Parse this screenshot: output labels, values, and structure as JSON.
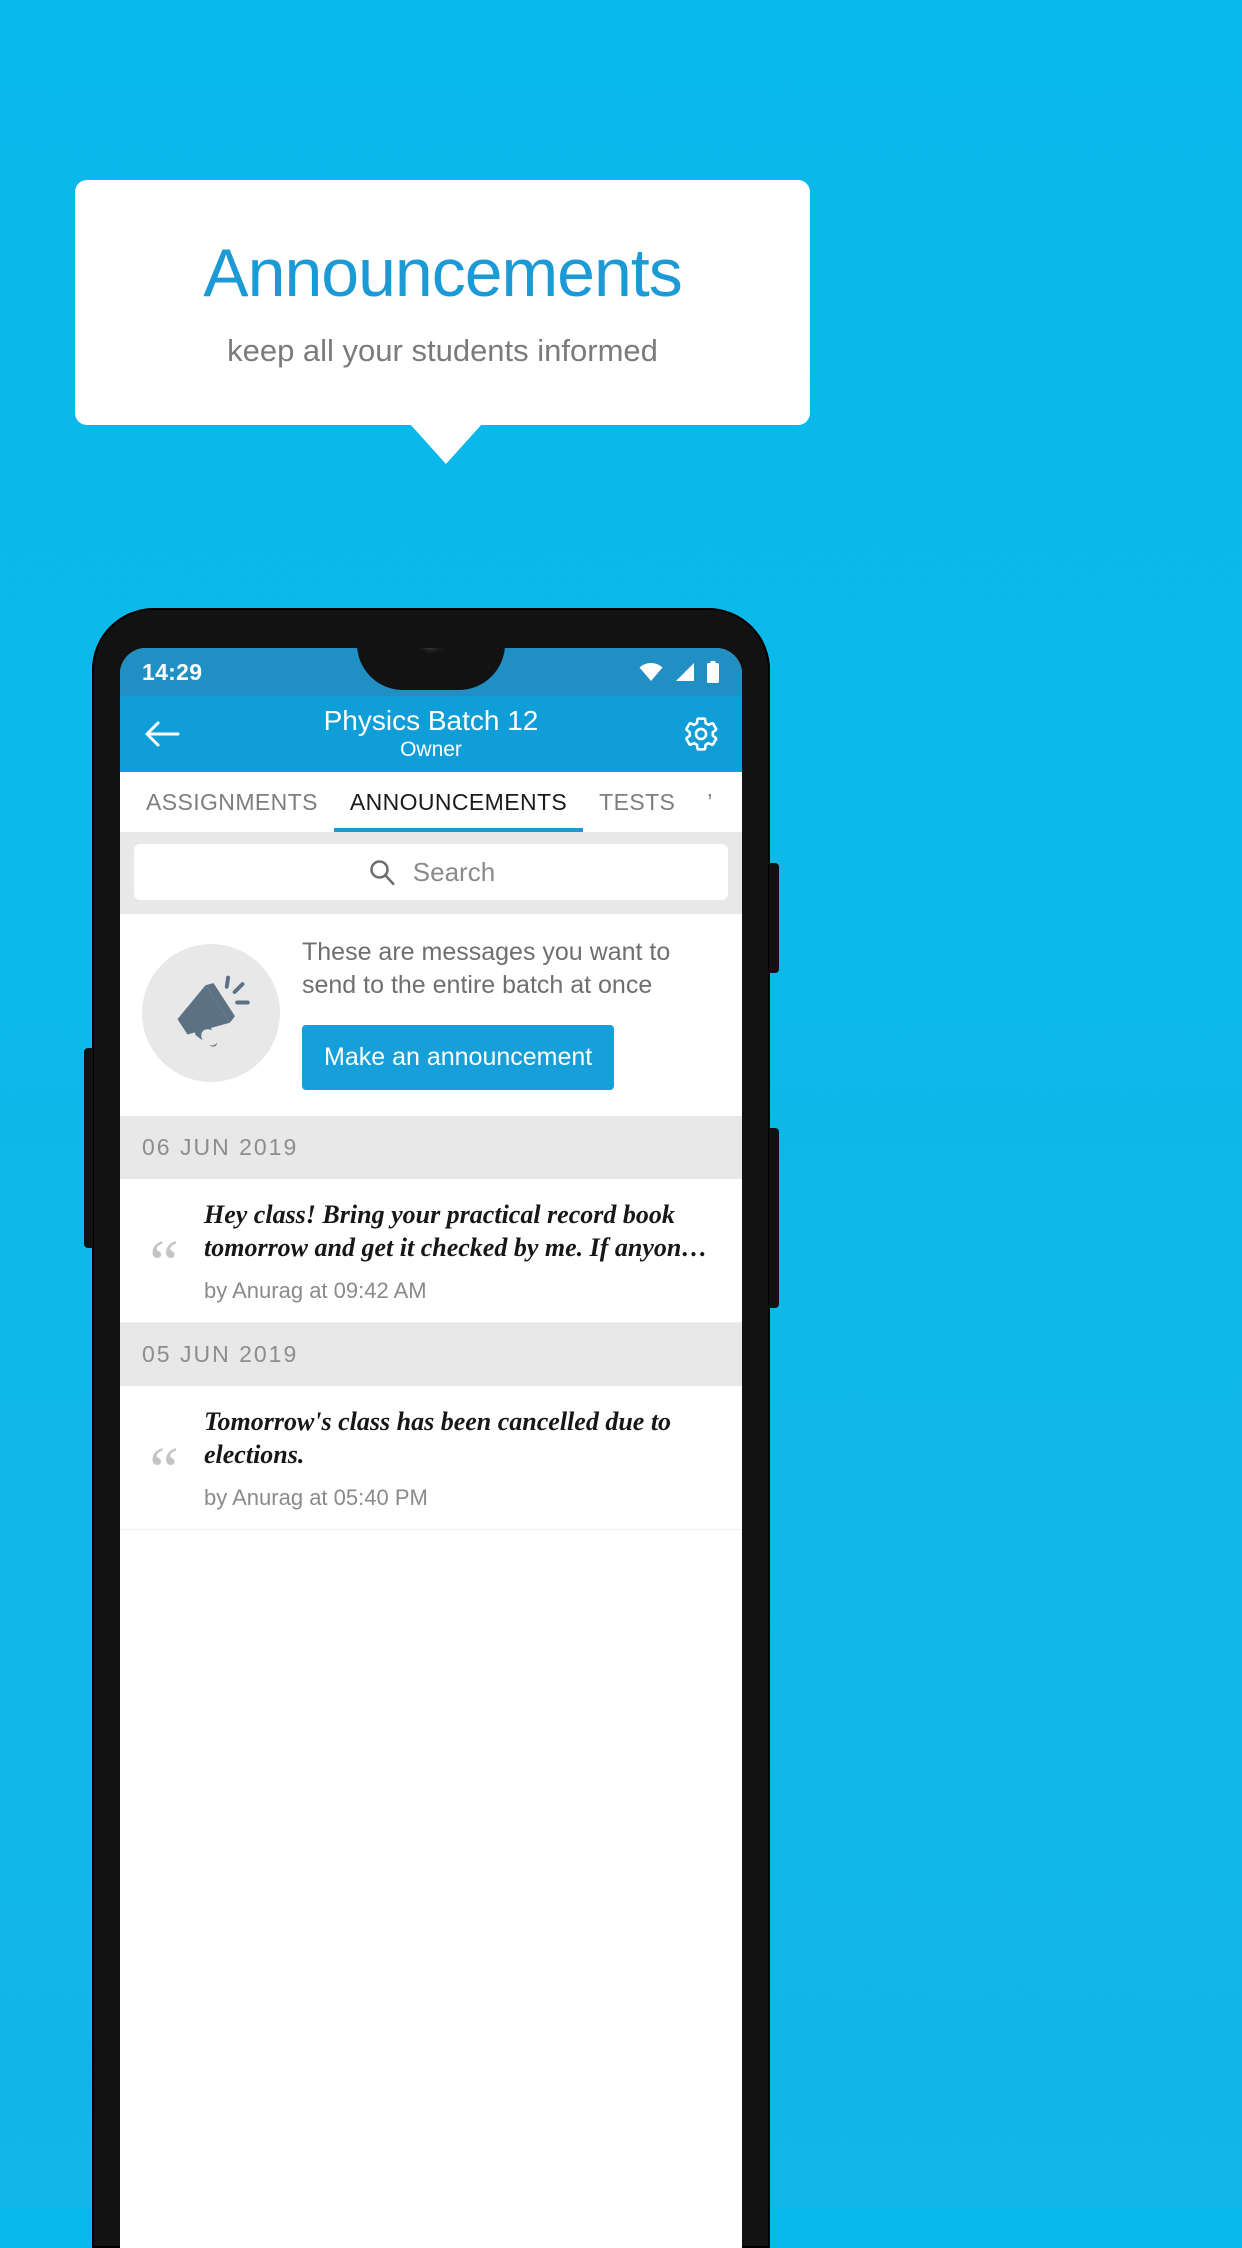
{
  "promo": {
    "title": "Announcements",
    "subtitle": "keep all your students informed",
    "title_color": "#1b9ad6",
    "background_color": "#0cb9ea"
  },
  "phone": {
    "status_bar": {
      "time": "14:29",
      "icons": [
        "wifi-icon",
        "signal-icon",
        "battery-icon"
      ]
    },
    "app_bar": {
      "back_icon": "back-arrow-icon",
      "title": "Physics Batch 12",
      "subtitle": "Owner",
      "settings_icon": "gear-icon",
      "color": "#109ed8"
    },
    "tabs": [
      {
        "label": "ASSIGNMENTS",
        "active": false
      },
      {
        "label": "ANNOUNCEMENTS",
        "active": true
      },
      {
        "label": "TESTS",
        "active": false
      },
      {
        "label": "’",
        "active": false
      }
    ],
    "search": {
      "icon": "search-icon",
      "placeholder": "Search",
      "value": ""
    },
    "hero": {
      "icon": "megaphone-icon",
      "text": "These are messages you want to send to the entire batch at once",
      "button_label": "Make an announcement",
      "button_color": "#169fd9"
    },
    "groups": [
      {
        "date": "06  JUN  2019",
        "items": [
          {
            "quote_icon": "quote-icon",
            "text": "Hey class! Bring your practical record book tomorrow and get it checked by me. If anyon…",
            "meta": "by Anurag at 09:42 AM"
          }
        ]
      },
      {
        "date": "05  JUN  2019",
        "items": [
          {
            "quote_icon": "quote-icon",
            "text": "Tomorrow's class has been cancelled due to elections.",
            "meta": "by Anurag at 05:40 PM"
          }
        ]
      }
    ]
  }
}
